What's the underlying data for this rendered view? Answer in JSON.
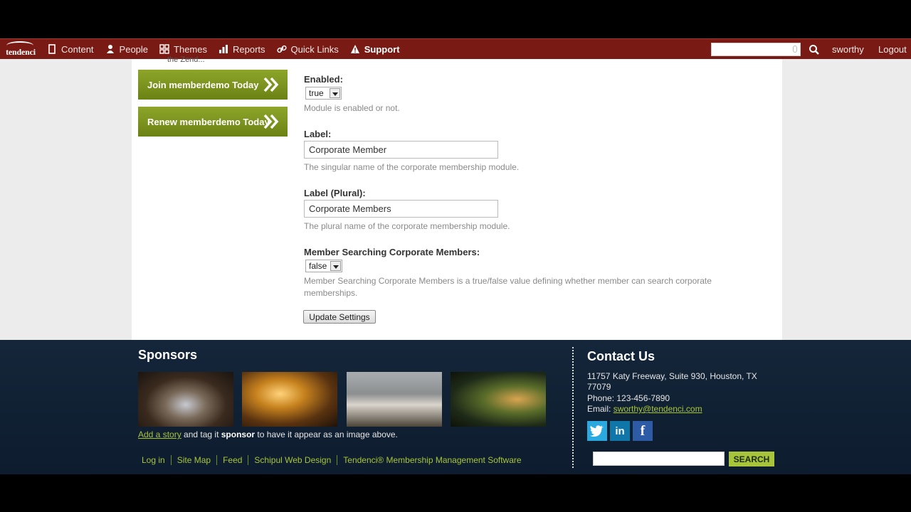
{
  "adminbar": {
    "logo_text": "tendenci",
    "nav": [
      {
        "label": "Content",
        "icon": "page-icon"
      },
      {
        "label": "People",
        "icon": "person-icon"
      },
      {
        "label": "Themes",
        "icon": "grid-icon"
      },
      {
        "label": "Reports",
        "icon": "bar-chart-icon"
      },
      {
        "label": "Quick Links",
        "icon": "link-icon"
      },
      {
        "label": "Support",
        "icon": "warning-icon"
      }
    ],
    "search_placeholder": "",
    "user": "sworthy",
    "logout": "Logout"
  },
  "sidebar": {
    "cut_text": "the Zend...",
    "join_label": "Join memberdemo Today",
    "renew_label": "Renew memberdemo Today"
  },
  "form": {
    "enabled": {
      "label": "Enabled:",
      "value": "true",
      "help": "Module is enabled or not."
    },
    "label": {
      "label": "Label:",
      "value": "Corporate Member",
      "help": "The singular name of the corporate membership module."
    },
    "label_plural": {
      "label": "Label (Plural):",
      "value": "Corporate Members",
      "help": "The plural name of the corporate membership module."
    },
    "member_search": {
      "label": "Member Searching Corporate Members:",
      "value": "false",
      "help": "Member Searching Corporate Members is a true/false value defining whether member can search corporate memberships."
    },
    "update_label": "Update Settings"
  },
  "footer": {
    "sponsors_title": "Sponsors",
    "add_story": "Add a story",
    "tag_text_1": " and tag it ",
    "sponsor_word": "sponsor",
    "tag_text_2": " to have it appear as an image above.",
    "links": [
      "Log in",
      "Site Map",
      "Feed",
      "Schipul Web Design",
      "Tendenci® Membership Management Software"
    ],
    "contact_title": "Contact Us",
    "address": "11757 Katy Freeway, Suite 930, Houston, TX 77079",
    "phone": "Phone: 123-456-7890",
    "email_label": "Email: ",
    "email": "sworthy@tendenci.com",
    "search_button": "SEARCH"
  },
  "colors": {
    "adminbar": "#7a1a14",
    "accent_green": "#a8c43a",
    "footer_bg": "#15263a"
  }
}
